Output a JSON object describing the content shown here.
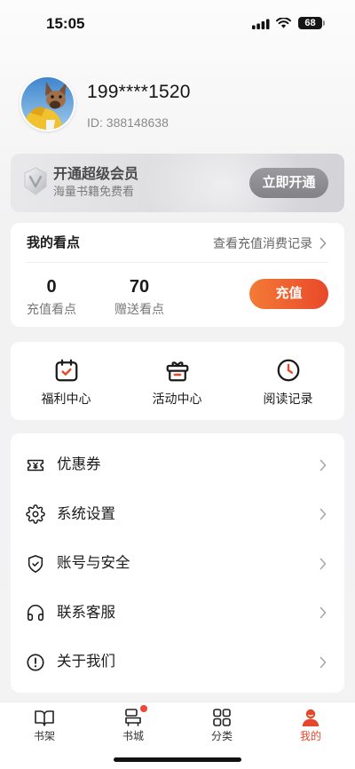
{
  "status_bar": {
    "time": "15:05",
    "battery": "68"
  },
  "profile": {
    "phone": "199****1520",
    "user_id": "ID: 388148638"
  },
  "vip_banner": {
    "icon": "vip-shield-icon",
    "title": "开通超级会员",
    "subtitle": "海量书籍免费看",
    "button": "立即开通"
  },
  "points": {
    "title": "我的看点",
    "records_link": "查看充值消费记录",
    "stats": [
      {
        "value": "0",
        "label": "充值看点"
      },
      {
        "value": "70",
        "label": "赠送看点"
      }
    ],
    "recharge_button": "充值"
  },
  "quick_actions": [
    {
      "label": "福利中心",
      "icon": "calendar-check-icon"
    },
    {
      "label": "活动中心",
      "icon": "gift-icon"
    },
    {
      "label": "阅读记录",
      "icon": "clock-icon"
    }
  ],
  "menu": [
    {
      "label": "优惠券",
      "icon": "coupon-icon"
    },
    {
      "label": "系统设置",
      "icon": "gear-icon"
    },
    {
      "label": "账号与安全",
      "icon": "shield-check-icon"
    },
    {
      "label": "联系客服",
      "icon": "headphones-icon"
    },
    {
      "label": "关于我们",
      "icon": "info-icon"
    }
  ],
  "tabbar": [
    {
      "label": "书架",
      "icon": "bookshelf-icon"
    },
    {
      "label": "书城",
      "icon": "bookstore-icon",
      "has_badge": true
    },
    {
      "label": "分类",
      "icon": "category-icon"
    },
    {
      "label": "我的",
      "icon": "profile-icon",
      "active": true
    }
  ],
  "colors": {
    "accent": "#e8492b",
    "accent_light": "#f47a36",
    "vip_button": "#8d8d92",
    "text": "#1b1b1b",
    "muted": "#888888"
  }
}
